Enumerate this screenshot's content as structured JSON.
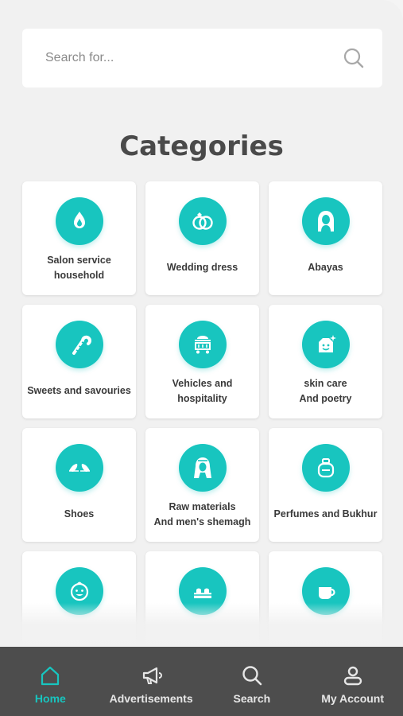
{
  "search": {
    "placeholder": "Search for..."
  },
  "page": {
    "title": "Categories"
  },
  "categories": [
    {
      "label": "Salon service\nhousehold",
      "icon": "flame-drop-icon"
    },
    {
      "label": "Wedding dress",
      "icon": "wedding-rings-icon"
    },
    {
      "label": "Abayas",
      "icon": "veiled-woman-icon"
    },
    {
      "label": "Sweets and savouries",
      "icon": "candy-cane-icon"
    },
    {
      "label": "Vehicles and hospitality",
      "icon": "serving-cart-icon"
    },
    {
      "label": "skin care\nAnd poetry",
      "icon": "face-cream-icon"
    },
    {
      "label": "Shoes",
      "icon": "shoes-icon"
    },
    {
      "label": "Raw materials\nAnd men's shemagh",
      "icon": "man-shemagh-icon"
    },
    {
      "label": "Perfumes and Bukhur",
      "icon": "perfume-bottle-icon"
    },
    {
      "label": "",
      "icon": "child-face-icon"
    },
    {
      "label": "",
      "icon": "cake-icon"
    },
    {
      "label": "",
      "icon": "coffee-cup-icon"
    }
  ],
  "nav": {
    "items": [
      {
        "label": "Home",
        "icon": "home-icon",
        "active": true
      },
      {
        "label": "Advertisements",
        "icon": "megaphone-icon",
        "active": false
      },
      {
        "label": "Search",
        "icon": "search-icon",
        "active": false
      },
      {
        "label": "My Account",
        "icon": "user-icon",
        "active": false
      }
    ]
  },
  "colors": {
    "accent": "#18c5bf",
    "navbar": "#4d4d4d",
    "background": "#f1f1f1"
  }
}
